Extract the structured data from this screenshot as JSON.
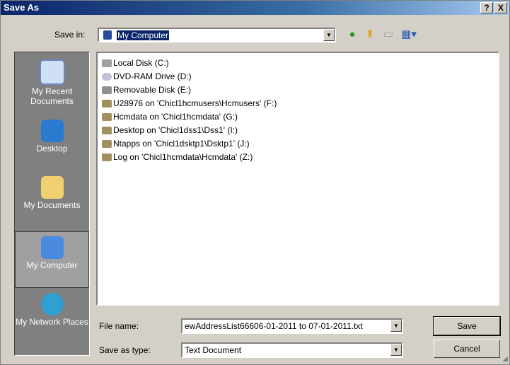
{
  "window": {
    "title": "Save As",
    "help": "?",
    "close": "X"
  },
  "toolbar": {
    "save_in_label": "Save in:",
    "save_in_value": "My Computer",
    "icons": [
      "back-icon",
      "up-folder-icon",
      "new-folder-icon",
      "view-menu-icon"
    ]
  },
  "places": [
    {
      "label": "My Recent Documents",
      "icon": "recent-documents-icon"
    },
    {
      "label": "Desktop",
      "icon": "desktop-icon"
    },
    {
      "label": "My Documents",
      "icon": "my-documents-icon"
    },
    {
      "label": "My Computer",
      "icon": "my-computer-icon",
      "active": true
    },
    {
      "label": "My Network Places",
      "icon": "network-places-icon"
    }
  ],
  "files": [
    {
      "label": "Local Disk (C:)",
      "icon": "hard-drive-icon"
    },
    {
      "label": "DVD-RAM Drive (D:)",
      "icon": "dvd-drive-icon"
    },
    {
      "label": "Removable Disk (E:)",
      "icon": "removable-disk-icon"
    },
    {
      "label": "U28976 on 'Chicl1hcmusers\\Hcmusers' (F:)",
      "icon": "network-drive-icon"
    },
    {
      "label": "Hcmdata on 'Chicl1hcmdata' (G:)",
      "icon": "network-drive-icon"
    },
    {
      "label": "Desktop on 'Chicl1dss1\\Dss1' (I:)",
      "icon": "network-drive-icon"
    },
    {
      "label": "Ntapps on 'Chicl1dsktp1\\Dsktp1' (J:)",
      "icon": "network-drive-icon"
    },
    {
      "label": "Log on 'Chicl1hcmdata\\Hcmdata' (Z:)",
      "icon": "network-drive-icon"
    }
  ],
  "footer": {
    "file_name_label": "File name:",
    "file_name_value": "ewAddressList66606-01-2011 to 07-01-2011.txt",
    "save_type_label": "Save as type:",
    "save_type_value": "Text Document",
    "save_button": "Save",
    "cancel_button": "Cancel"
  }
}
